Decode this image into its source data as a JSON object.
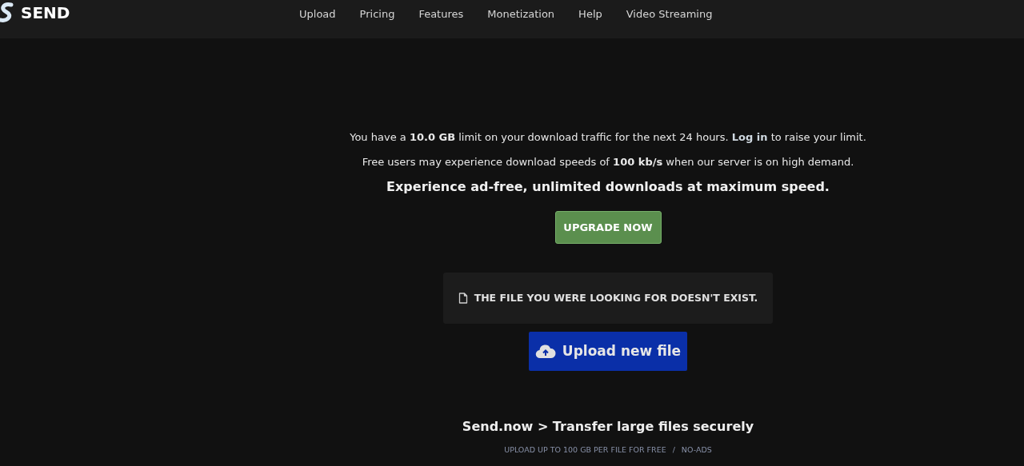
{
  "header": {
    "logo": "SEND",
    "nav": [
      "Upload",
      "Pricing",
      "Features",
      "Monetization",
      "Help",
      "Video Streaming"
    ]
  },
  "notice": {
    "before": "You have a **10.0 GB** limit on your download traffic for the next 24 hours.",
    "link": "Log in",
    "after": "to raise your limit."
  },
  "speed_note": "Free users may experience download speeds of **100 kb/s** when our server is on high demand.",
  "promo": "Experience ad-free, unlimited downloads at maximum speed.",
  "upgrade_button": "UPGRADE NOW",
  "error_message": "THE FILE YOU WERE LOOKING FOR DOESN'T EXIST.",
  "upload_button": "Upload new file",
  "footer": {
    "title": "Send.now > Transfer large files securely",
    "features": [
      "UPLOAD UP TO 100 GB PER FILE FOR FREE",
      "NO-ADS"
    ],
    "separator": "/"
  }
}
